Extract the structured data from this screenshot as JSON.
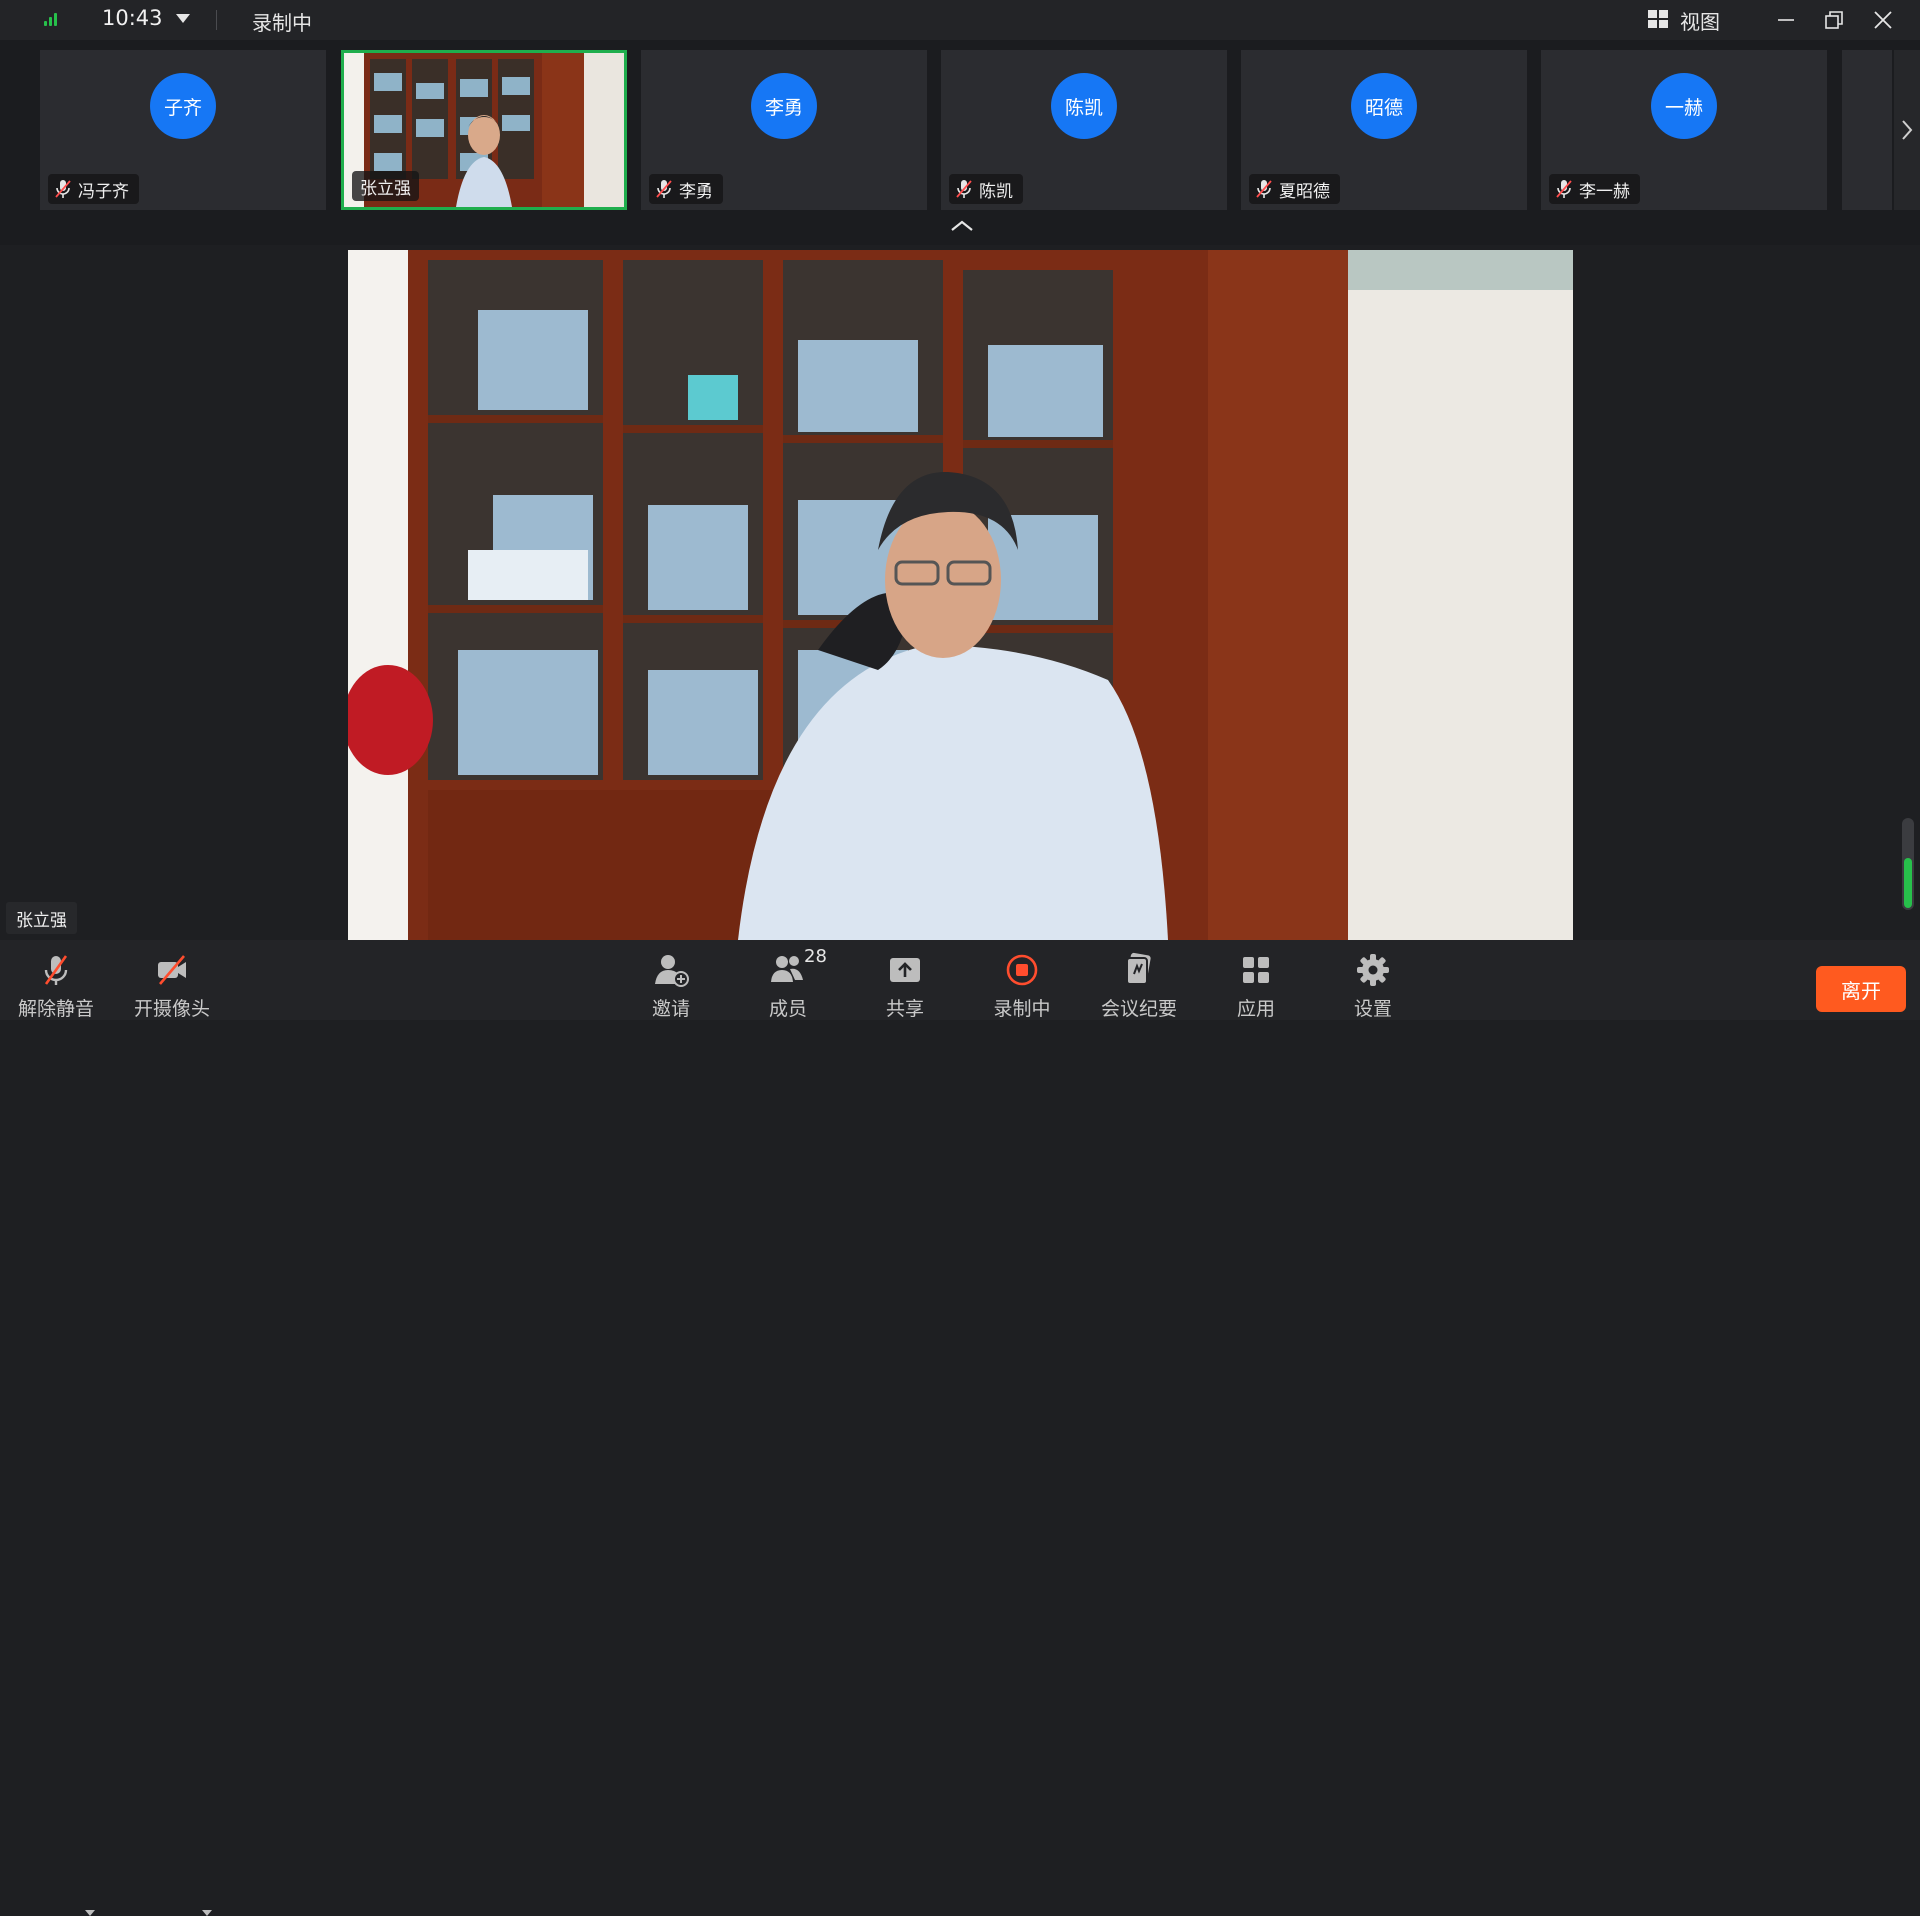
{
  "titlebar": {
    "time": "10:43",
    "recording_status": "录制中",
    "view_label": "视图"
  },
  "participants": [
    {
      "avatar": "子齐",
      "name": "冯子齐",
      "muted": true,
      "video": false
    },
    {
      "avatar": "",
      "name": "张立强",
      "muted": false,
      "video": true,
      "active": true
    },
    {
      "avatar": "李勇",
      "name": "李勇",
      "muted": true,
      "video": false
    },
    {
      "avatar": "陈凯",
      "name": "陈凯",
      "muted": true,
      "video": false
    },
    {
      "avatar": "昭德",
      "name": "夏昭德",
      "muted": true,
      "video": false
    },
    {
      "avatar": "一赫",
      "name": "李一赫",
      "muted": true,
      "video": false
    }
  ],
  "main_video": {
    "speaker_name": "张立强"
  },
  "toolbar": {
    "unmute_label": "解除静音",
    "camera_label": "开摄像头",
    "invite_label": "邀请",
    "members_label": "成员",
    "members_count": "28",
    "share_label": "共享",
    "recording_label": "录制中",
    "minutes_label": "会议纪要",
    "apps_label": "应用",
    "settings_label": "设置",
    "leave_label": "离开"
  },
  "colors": {
    "accent_blue": "#1677f5",
    "active_green": "#1fae4d",
    "leave_orange": "#ff5a1f",
    "record_red": "#ff4d2e"
  },
  "icons": [
    "signal-icon",
    "chevron-down-icon",
    "view-grid-icon",
    "minimize-icon",
    "restore-icon",
    "close-icon",
    "mic-off-icon",
    "camera-off-icon",
    "invite-icon",
    "members-icon",
    "share-icon",
    "record-icon",
    "minutes-icon",
    "apps-icon",
    "settings-icon",
    "chevron-right-icon",
    "chevron-up-icon"
  ]
}
